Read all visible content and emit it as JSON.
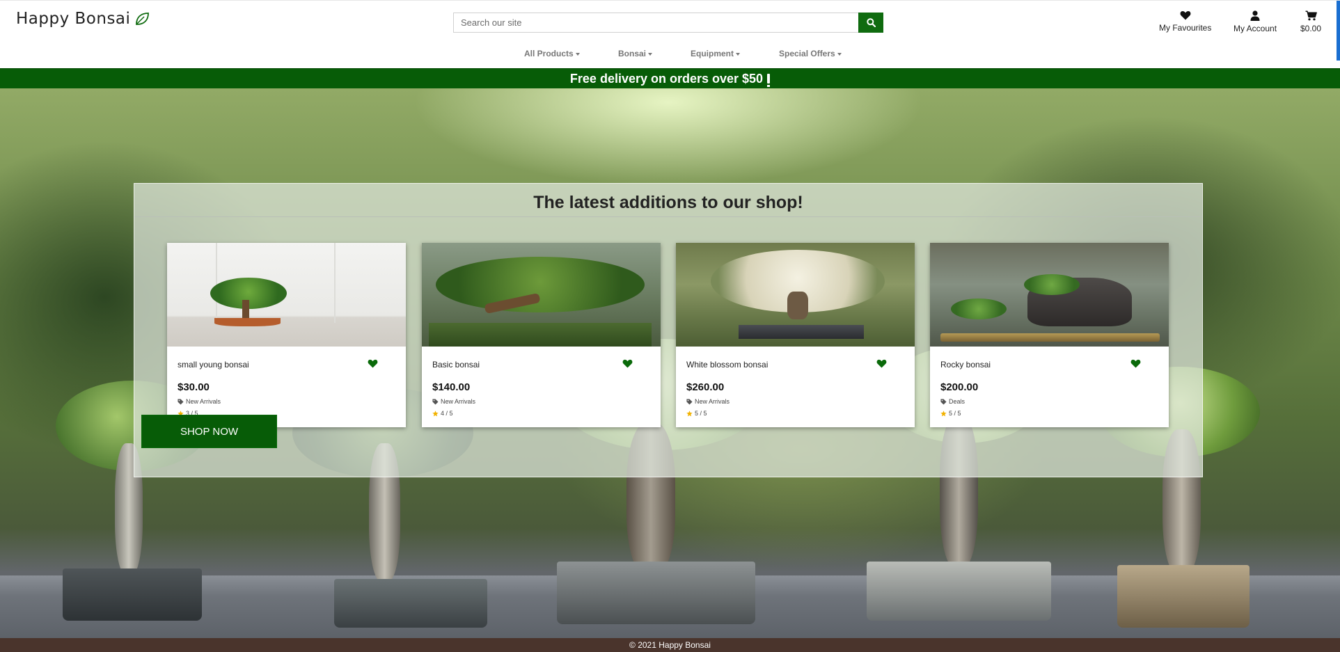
{
  "brand": {
    "name": "Happy Bonsai",
    "logo_icon": "leaf-icon"
  },
  "search": {
    "placeholder": "Search our site",
    "value": ""
  },
  "account": {
    "favourites_label": "My Favourites",
    "account_label": "My Account",
    "cart_total": "$0.00"
  },
  "nav": [
    {
      "label": "All Products"
    },
    {
      "label": "Bonsai"
    },
    {
      "label": "Equipment"
    },
    {
      "label": "Special Offers"
    }
  ],
  "banner": {
    "text": "Free delivery on orders over $50"
  },
  "latest": {
    "title": "The latest additions to our shop!",
    "products": [
      {
        "name": "small young bonsai",
        "price": "$30.00",
        "category": "New Arrivals",
        "rating": "3 / 5"
      },
      {
        "name": "Basic bonsai",
        "price": "$140.00",
        "category": "New Arrivals",
        "rating": "4 / 5"
      },
      {
        "name": "White blossom bonsai",
        "price": "$260.00",
        "category": "New Arrivals",
        "rating": "5 / 5"
      },
      {
        "name": "Rocky bonsai",
        "price": "$200.00",
        "category": "Deals",
        "rating": "5 / 5"
      }
    ]
  },
  "hero": {
    "cta_label": "SHOP NOW"
  },
  "footer": {
    "text": "© 2021 Happy Bonsai"
  },
  "colors": {
    "brand_green": "#075c07",
    "footer_brown": "#4a342c",
    "star": "#f2b200"
  }
}
